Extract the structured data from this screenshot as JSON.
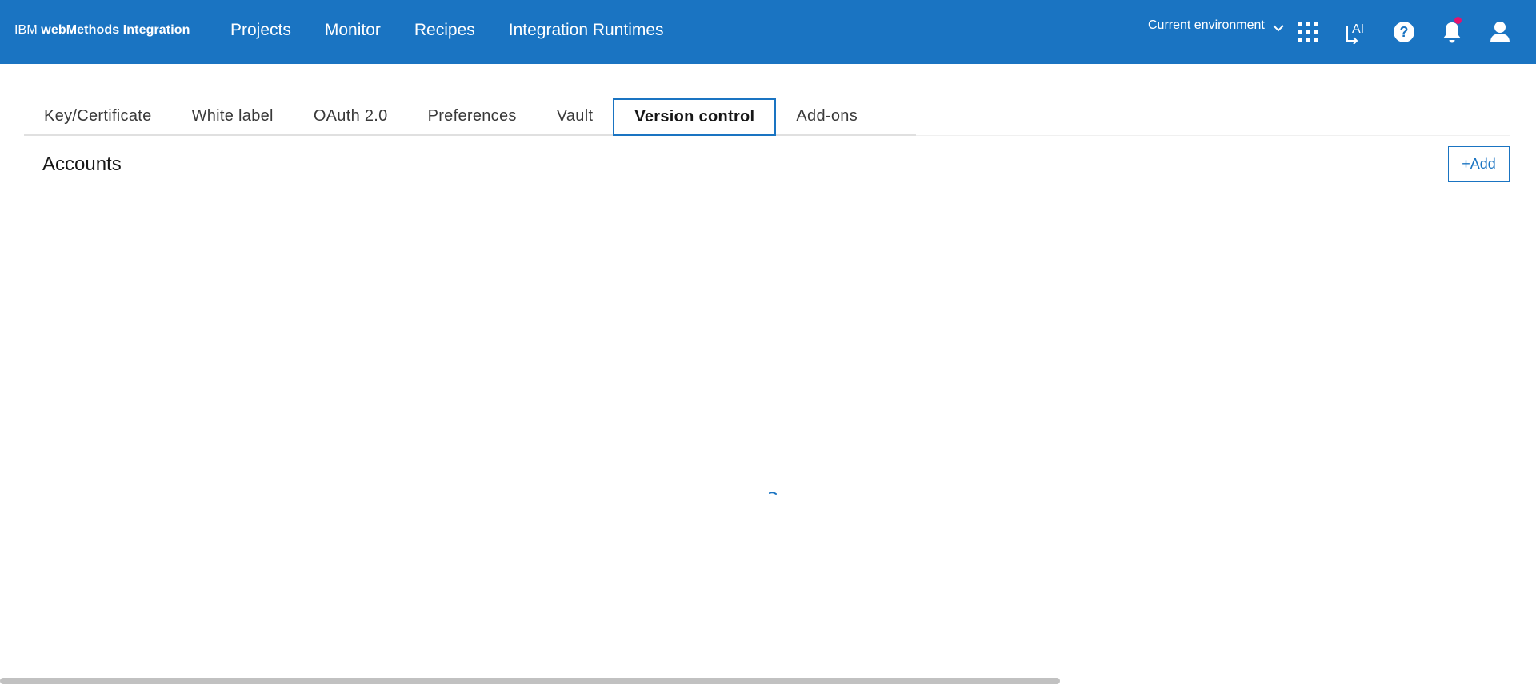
{
  "header": {
    "brand_prefix": "IBM",
    "brand_product": "webMethods Integration",
    "nav": [
      "Projects",
      "Monitor",
      "Recipes",
      "Integration Runtimes"
    ],
    "environment_label": "Current environment",
    "icons": [
      "app-switcher-icon",
      "ai-assistant-icon",
      "help-icon",
      "notification-icon",
      "user-icon"
    ],
    "accent_color": "#1a74c2",
    "notification_dot_color": "#e5126e"
  },
  "tabs": {
    "items": [
      "Key/Certificate",
      "White label",
      "OAuth 2.0",
      "Preferences",
      "Vault",
      "Version control",
      "Add-ons"
    ],
    "active": "Version control"
  },
  "accounts": {
    "title": "Accounts",
    "add_label": "+Add"
  },
  "status": {
    "loading": true
  }
}
